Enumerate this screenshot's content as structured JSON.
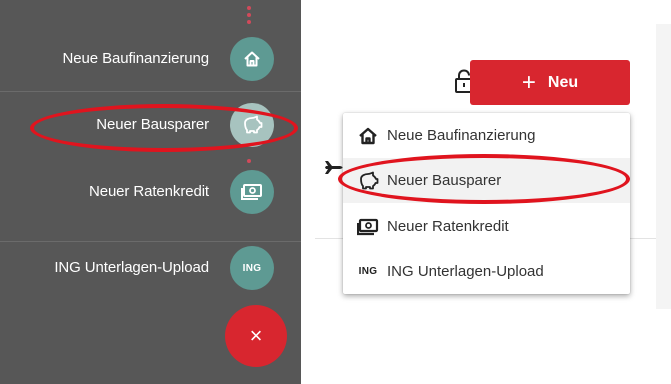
{
  "left_menu": {
    "items": [
      {
        "label": "Neue Baufinanzierung",
        "icon": "house-icon",
        "icon_text": ""
      },
      {
        "label": "Neuer Bausparer",
        "icon": "piggy-bank-icon",
        "icon_text": ""
      },
      {
        "label": "Neuer Ratenkredit",
        "icon": "money-bill-icon",
        "icon_text": ""
      },
      {
        "label": "ING Unterlagen-Upload",
        "icon": "ing-icon",
        "icon_text": "ING"
      }
    ],
    "close_label": "×"
  },
  "toolbar": {
    "new_button_plus": "+",
    "new_button_label": "Neu",
    "lock_icon": "lock-icon"
  },
  "dropdown": {
    "items": [
      {
        "label": "Neue Baufinanzierung",
        "icon": "house-icon",
        "icon_text": ""
      },
      {
        "label": "Neuer Bausparer",
        "icon": "piggy-bank-icon",
        "icon_text": "",
        "highlighted": true
      },
      {
        "label": "Neuer Ratenkredit",
        "icon": "money-bill-icon",
        "icon_text": ""
      },
      {
        "label": "ING Unterlagen-Upload",
        "icon": "ing-icon",
        "icon_text": "ING"
      }
    ]
  },
  "colors": {
    "fab_panel_bg": "#575757",
    "fab_circle": "#5e9a93",
    "accent_red": "#d8262f",
    "annotation_red": "#e0141e"
  }
}
